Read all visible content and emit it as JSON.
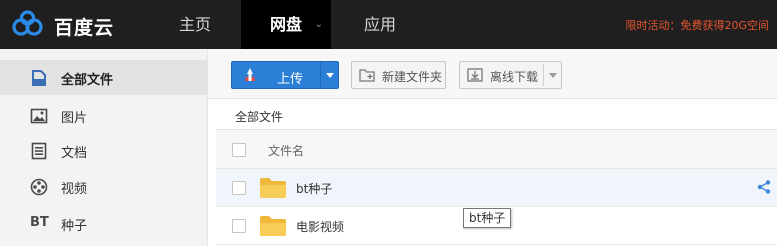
{
  "header": {
    "logo_text": "百度云",
    "nav": {
      "home": "主页",
      "pan": "网盘",
      "apps": "应用"
    },
    "promo": "限时活动：免费获得20G空间"
  },
  "sidebar": {
    "items": [
      {
        "label": "全部文件",
        "icon": "file-icon"
      },
      {
        "label": "图片",
        "icon": "image-icon"
      },
      {
        "label": "文档",
        "icon": "document-icon"
      },
      {
        "label": "视频",
        "icon": "video-reel-icon"
      },
      {
        "label": "种子",
        "icon": "bt-icon",
        "icon_text": "BT"
      }
    ]
  },
  "toolbar": {
    "upload_label": "上传",
    "new_folder_label": "新建文件夹",
    "offline_download_label": "离线下载"
  },
  "breadcrumb": "全部文件",
  "file_list": {
    "column_header": "文件名",
    "rows": [
      {
        "name": "bt种子"
      },
      {
        "name": "电影视频"
      }
    ]
  },
  "tooltip": "bt种子",
  "colors": {
    "topbar": "#1f1f1f",
    "accent_blue": "#2b7fd6",
    "promo_orange": "#e8542e",
    "folder_yellow": "#f5c542"
  }
}
